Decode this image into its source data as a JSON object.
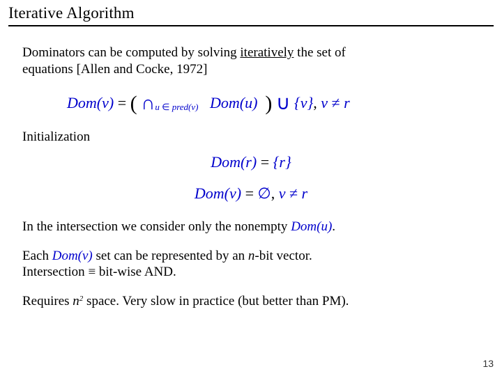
{
  "title": "Iterative Algorithm",
  "intro": {
    "line1": "Dominators can be computed by solving ",
    "iteratively": "iteratively",
    "line1b": " the set of",
    "line2": "equations [Allen and Cocke, 1972]"
  },
  "eq_main": {
    "domv": "Dom(v)",
    "eq": " = ",
    "lp": "(",
    "rp": ")",
    "cap": "∩",
    "cup": "∪",
    "sub_u": "u ",
    "sub_in": "∈",
    "sub_pred": " pred(v)",
    "domu": "Dom(u)",
    "set_v": " {v}",
    "comma": ",   ",
    "v": "v ",
    "ne": "≠",
    "r": " r"
  },
  "init_label": "Initialization",
  "eq_init1": {
    "domr": "Dom(r)",
    "eq": " = ",
    "setr": "{r}"
  },
  "eq_init2": {
    "domv": "Dom(v)",
    "eq": " = ",
    "empty": "∅",
    "comma": ",   ",
    "v": "v ",
    "ne": "≠",
    "r": " r"
  },
  "note_intersection": {
    "a": "In the intersection we consider only the nonempty ",
    "domu": "Dom(u)",
    "dot": "."
  },
  "note_bitvec": {
    "a": "Each  ",
    "domv": "Dom(v)",
    "b": "  set can be represented by an ",
    "n": "n",
    "c": "-bit vector.",
    "d": "Intersection ",
    "equiv": "≡",
    "e": " bit-wise AND."
  },
  "note_complexity": {
    "a": "Requires  ",
    "n": "n",
    "two": "2",
    "b": "  space. Very slow in practice (but better than PM)."
  },
  "page": "13"
}
